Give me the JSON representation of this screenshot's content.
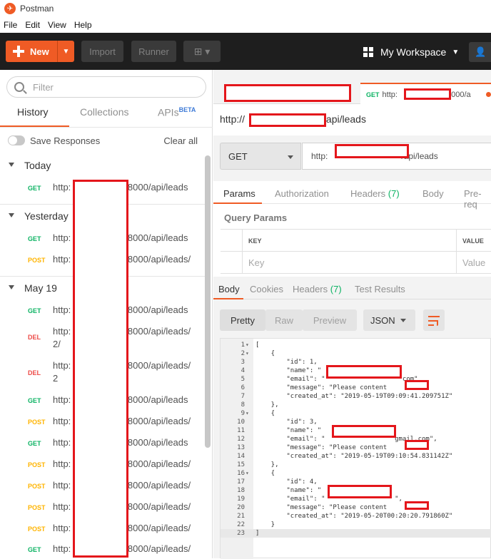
{
  "window": {
    "title": "Postman"
  },
  "menu": [
    "File",
    "Edit",
    "View",
    "Help"
  ],
  "toolbar": {
    "new_label": "New",
    "import_label": "Import",
    "runner_label": "Runner",
    "workspace_label": "My Workspace"
  },
  "sidebar": {
    "filter_placeholder": "Filter",
    "tabs": [
      "History",
      "Collections",
      "APIs"
    ],
    "beta_badge": "BETA",
    "save_responses_label": "Save Responses",
    "clear_all_label": "Clear all",
    "groups": [
      {
        "name": "Today",
        "items": [
          {
            "method": "GET",
            "url_start": "http:",
            "url_end": ":8000/api/leads"
          }
        ]
      },
      {
        "name": "Yesterday",
        "items": [
          {
            "method": "GET",
            "url_start": "http:",
            "url_end": ":8000/api/leads"
          },
          {
            "method": "POST",
            "url_start": "http:",
            "url_end": ":8000/api/leads/"
          }
        ]
      },
      {
        "name": "May 19",
        "items": [
          {
            "method": "GET",
            "url_start": "http:",
            "url_end": ":8000/api/leads"
          },
          {
            "method": "DEL",
            "url_start": "http:",
            "url_end": ":8000/api/leads/",
            "url_line2": "2/"
          },
          {
            "method": "DEL",
            "url_start": "http:",
            "url_end": ":8000/api/leads/",
            "url_line2": "2"
          },
          {
            "method": "GET",
            "url_start": "http:",
            "url_end": ":8000/api/leads"
          },
          {
            "method": "POST",
            "url_start": "http:",
            "url_end": ":8000/api/leads/"
          },
          {
            "method": "GET",
            "url_start": "http:",
            "url_end": ":8000/api/leads"
          },
          {
            "method": "POST",
            "url_start": "http:",
            "url_end": ":8000/api/leads/"
          },
          {
            "method": "POST",
            "url_start": "http:",
            "url_end": ":8000/api/leads/"
          },
          {
            "method": "POST",
            "url_start": "http:",
            "url_end": ":8000/api/leads/"
          },
          {
            "method": "POST",
            "url_start": "http:",
            "url_end": ":8000/api/leads/"
          },
          {
            "method": "GET",
            "url_start": "http:",
            "url_end": ":8000/api/leads/"
          }
        ]
      }
    ]
  },
  "request_tab": {
    "method": "GET",
    "url_start": "http:",
    "url_end": ":8000/a"
  },
  "request": {
    "title_start": "http://",
    "title_end": "/api/leads",
    "method": "GET",
    "url_start": "http:",
    "url_end": "/api/leads",
    "tabs": [
      {
        "label": "Params"
      },
      {
        "label": "Authorization"
      },
      {
        "label": "Headers",
        "count": "(7)"
      },
      {
        "label": "Body"
      },
      {
        "label": "Pre-req"
      }
    ],
    "query_params_title": "Query Params",
    "key_header": "KEY",
    "value_header": "VALUE",
    "key_placeholder": "Key",
    "value_placeholder": "Value"
  },
  "response": {
    "tabs": [
      {
        "label": "Body"
      },
      {
        "label": "Cookies"
      },
      {
        "label": "Headers",
        "count": "(7)"
      },
      {
        "label": "Test Results"
      }
    ],
    "formats": [
      "Pretty",
      "Raw",
      "Preview"
    ],
    "lang": "JSON",
    "code_lines": [
      {
        "n": "1",
        "fold": "▾",
        "html": "["
      },
      {
        "n": "2",
        "fold": "▾",
        "html": "    {"
      },
      {
        "n": "3",
        "fold": "",
        "html": "        \"id\": 1,"
      },
      {
        "n": "4",
        "fold": "",
        "html": "        \"name\": \""
      },
      {
        "n": "5",
        "fold": "",
        "html": "        \"email\": \"                    com\""
      },
      {
        "n": "6",
        "fold": "",
        "html": "        \"message\": \"Please content "
      },
      {
        "n": "7",
        "fold": "",
        "html": "        \"created_at\": \"2019-05-19T09:09:41.209751Z\""
      },
      {
        "n": "8",
        "fold": "",
        "html": "    },"
      },
      {
        "n": "9",
        "fold": "▾",
        "html": "    {"
      },
      {
        "n": "10",
        "fold": "",
        "html": "        \"id\": 3,"
      },
      {
        "n": "11",
        "fold": "",
        "html": "        \"name\": \""
      },
      {
        "n": "12",
        "fold": "",
        "html": "        \"email\": \"                  gmail.com\","
      },
      {
        "n": "13",
        "fold": "",
        "html": "        \"message\": \"Please content "
      },
      {
        "n": "14",
        "fold": "",
        "html": "        \"created_at\": \"2019-05-19T09:10:54.831142Z\""
      },
      {
        "n": "15",
        "fold": "",
        "html": "    },"
      },
      {
        "n": "16",
        "fold": "▾",
        "html": "    {"
      },
      {
        "n": "17",
        "fold": "",
        "html": "        \"id\": 4,"
      },
      {
        "n": "18",
        "fold": "",
        "html": "        \"name\": \""
      },
      {
        "n": "19",
        "fold": "",
        "html": "        \"email\": \"                  \","
      },
      {
        "n": "20",
        "fold": "",
        "html": "        \"message\": \"Please content "
      },
      {
        "n": "21",
        "fold": "",
        "html": "        \"created_at\": \"2019-05-20T00:20:20.791860Z\""
      },
      {
        "n": "22",
        "fold": "",
        "html": "    }"
      },
      {
        "n": "23",
        "fold": "",
        "html": "]"
      }
    ]
  },
  "colors": {
    "accent": "#ef5b25",
    "get": "#0cb363",
    "post": "#ffb400",
    "delete": "#ed4b48",
    "redaction": "#e4161b"
  }
}
